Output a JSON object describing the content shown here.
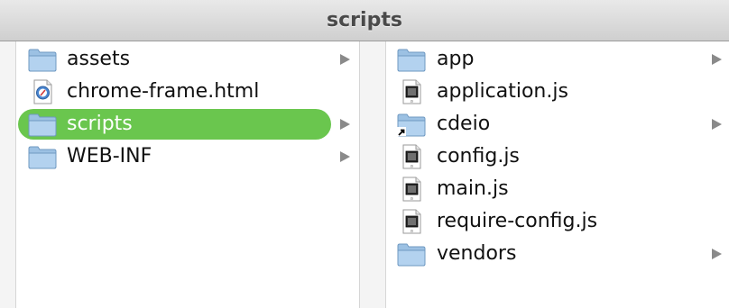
{
  "window": {
    "title": "scripts"
  },
  "colors": {
    "selection": "#6ac64e",
    "folder": "#9cc1e3",
    "arrow": "#8a8a8a"
  },
  "column1": {
    "items": [
      {
        "label": "assets",
        "icon": "folder-icon",
        "has_children": true
      },
      {
        "label": "chrome-frame.html",
        "icon": "html-file-icon",
        "has_children": false
      },
      {
        "label": "scripts",
        "icon": "folder-icon",
        "has_children": true,
        "selected": true
      },
      {
        "label": "WEB-INF",
        "icon": "folder-icon",
        "has_children": true
      }
    ]
  },
  "column2": {
    "items": [
      {
        "label": "app",
        "icon": "folder-icon",
        "has_children": true
      },
      {
        "label": "application.js",
        "icon": "js-file-icon",
        "has_children": false
      },
      {
        "label": "cdeio",
        "icon": "folder-alias-icon",
        "has_children": true
      },
      {
        "label": "config.js",
        "icon": "js-file-icon",
        "has_children": false
      },
      {
        "label": "main.js",
        "icon": "js-file-icon",
        "has_children": false
      },
      {
        "label": "require-config.js",
        "icon": "js-file-icon",
        "has_children": false
      },
      {
        "label": "vendors",
        "icon": "folder-icon",
        "has_children": true
      }
    ]
  }
}
